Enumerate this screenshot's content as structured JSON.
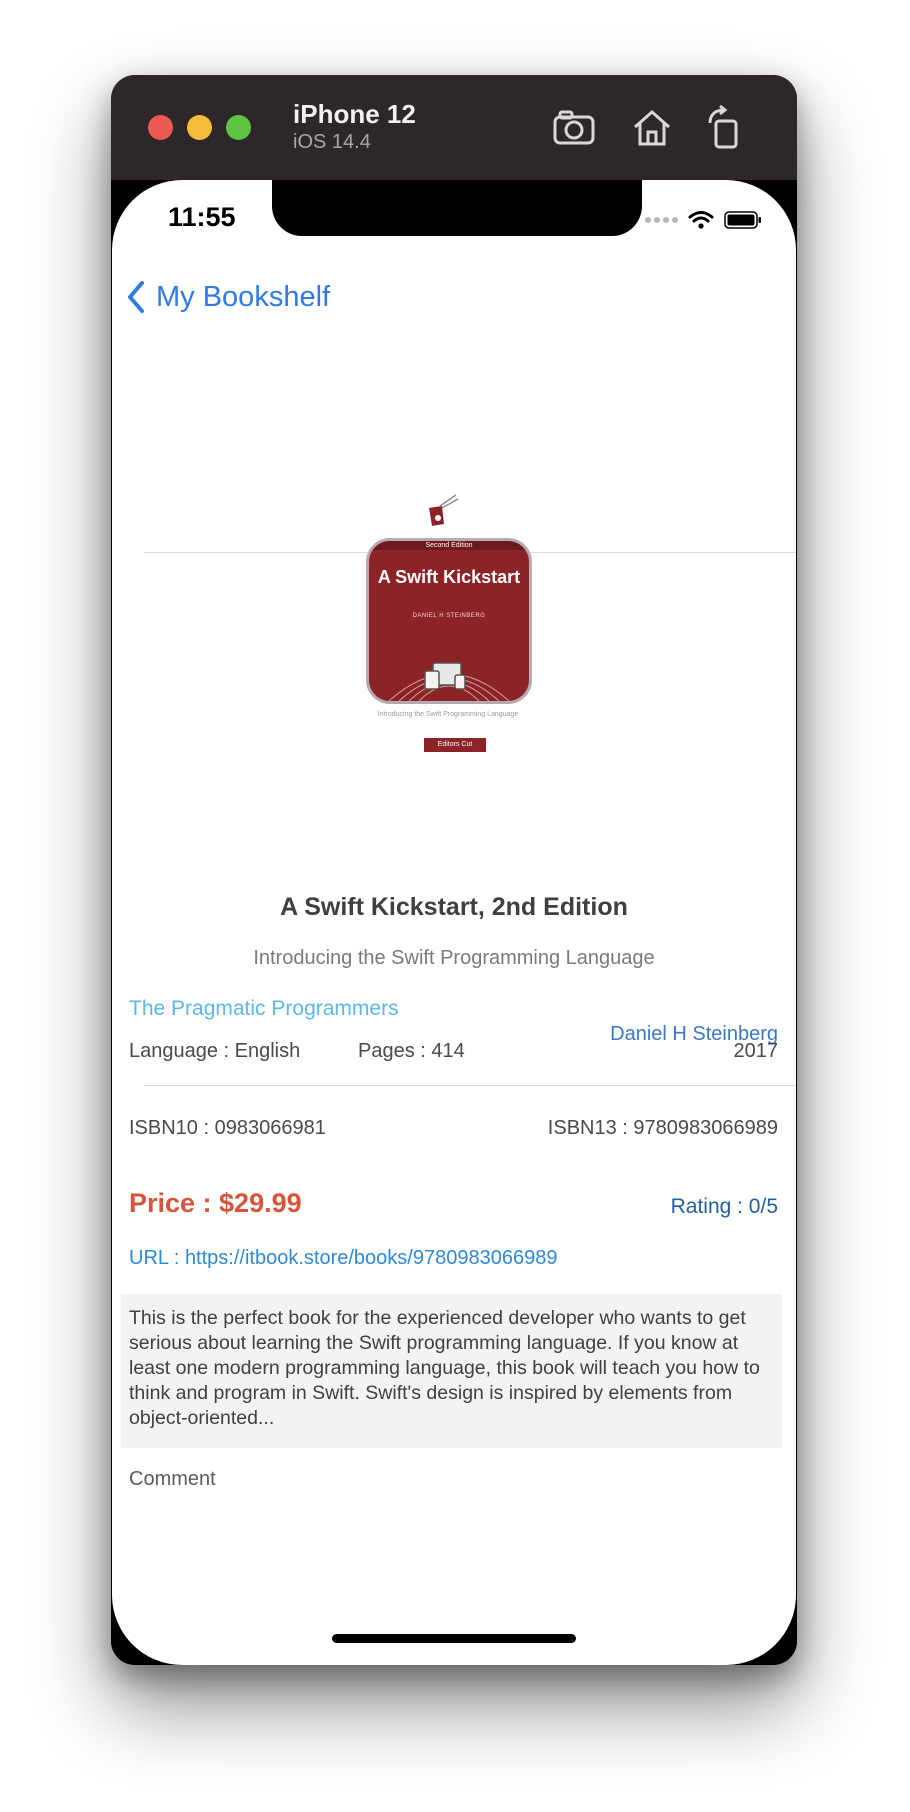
{
  "device": {
    "name": "iPhone 12",
    "os": "iOS 14.4"
  },
  "status_bar": {
    "time": "11:55"
  },
  "nav": {
    "back_label": "My Bookshelf"
  },
  "cover": {
    "edition_label": "Second Edition",
    "title": "A Swift Kickstart",
    "author": "DANIEL H STEINBERG",
    "subtitle": "Introducing the Swift Programming Language",
    "publisher": "Editors Cut"
  },
  "book": {
    "title": "A Swift Kickstart, 2nd Edition",
    "subtitle": "Introducing the Swift Programming Language",
    "publisher": "The Pragmatic Programmers",
    "author": "Daniel H Steinberg",
    "language": "Language : English",
    "pages": "Pages : 414",
    "year": "2017",
    "isbn10": "ISBN10 : 0983066981",
    "isbn13": "ISBN13 : 9780983066989",
    "price": "Price : $29.99",
    "rating": "Rating : 0/5",
    "url": "URL : https://itbook.store/books/9780983066989",
    "description": "This is the perfect book for the experienced developer who wants to get serious about learning the Swift programming language. If you know at least one modern programming language, this book will teach you how to think and program in Swift. Swift's design is inspired by elements from object-oriented...",
    "comment_placeholder": "Comment"
  },
  "colors": {
    "link_blue": "#2f7ae6",
    "publisher": "#5cb9e6",
    "author": "#3c78c3",
    "price": "#d6553b",
    "rating": "#24609f",
    "cover": "#8c2427"
  }
}
